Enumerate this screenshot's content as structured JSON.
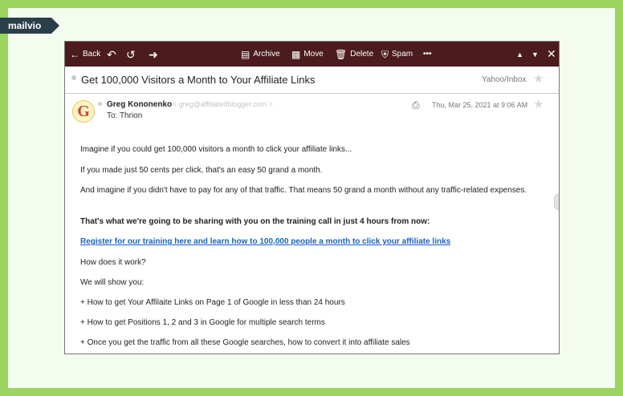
{
  "brand": "mailvio",
  "toolbar": {
    "back_label": "Back",
    "archive_label": "Archive",
    "move_label": "Move",
    "delete_label": "Delete",
    "spam_label": "Spam",
    "more_label": "•••"
  },
  "message": {
    "subject": "Get 100,000 Visitors a Month to Your Affiliate Links",
    "folder": "Yahoo/Inbox",
    "sender_name": "Greg Kononenko",
    "sender_email": "< greg@affiliatedblogger.com >",
    "to_line": "To: Thrion",
    "date": "Thu, Mar 25, 2021 at 9:06 AM",
    "avatar_letter": "G",
    "body": [
      "Imagine if you could get 100,000 visitors a month to click your affiliate links...",
      "If you made just 50 cents per click, that's an easy 50 grand a month.",
      "And imagine if you didn't have to pay for any of that traffic. That means 50 grand a month without any traffic-related expenses.",
      "That's what we're going to be sharing with you on the training call in just 4 hours from now:",
      "Register for our training here and learn how to 100,000 people a month to click your affiliate links",
      "How does it work?",
      "We will show you:",
      "+ How to get Your Affilaite Links on Page 1 of Google in less than 24 hours",
      "+ How to get Positions 1, 2 and 3 in Google for multiple search terms",
      "+ Once you get the traffic from all these Google searches, how to convert it into affiliate sales"
    ]
  },
  "colors": {
    "outer_border": "#9dd35f",
    "toolbar_bg": "#4b1b1d",
    "link": "#1a62c0"
  }
}
